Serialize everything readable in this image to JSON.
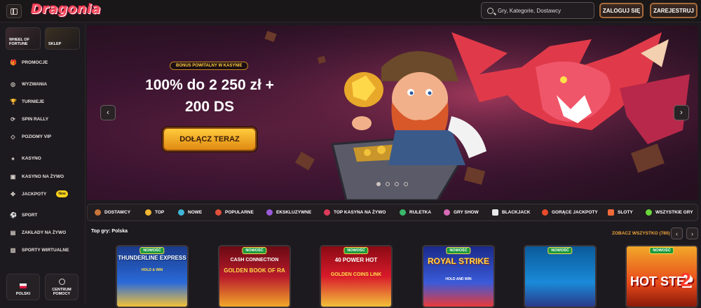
{
  "header": {
    "logo": "Dragonia",
    "search_placeholder": "Gry, Kategorie, Dostawcy",
    "login_label": "ZALOGUJ SIĘ",
    "register_label": "ZAREJESTRUJ"
  },
  "sidebar": {
    "tiles": [
      "WHEEL OF FORTUNE",
      "SKLEP"
    ],
    "items": [
      {
        "label": "PROMOCJE",
        "icon": "gift-icon"
      },
      {
        "label": "WYZWANIA",
        "icon": "target-icon"
      },
      {
        "label": "TURNIEJE",
        "icon": "trophy-icon"
      },
      {
        "label": "SPIN RALLY",
        "icon": "spin-icon"
      },
      {
        "label": "POZIOMY VIP",
        "icon": "diamond-icon"
      },
      {
        "label": "KASYNO",
        "icon": "cards-icon"
      },
      {
        "label": "KASYNO NA ŻYWO",
        "icon": "live-icon"
      },
      {
        "label": "JACKPOTY",
        "icon": "jackpot-icon",
        "badge": "New"
      },
      {
        "label": "SPORT",
        "icon": "ball-icon"
      },
      {
        "label": "ZAKŁADY NA ŻYWO",
        "icon": "live-bet-icon"
      },
      {
        "label": "SPORTY WIRTUALNE",
        "icon": "virtual-icon"
      }
    ],
    "language_label": "POLSKI",
    "help_label": "CENTRUM POMOCY"
  },
  "banner": {
    "tag": "BONUS POWITALNY W KASYNIE",
    "line1": "100% do 2 250 zł +",
    "line2": "200 DS",
    "cta": "DOŁĄCZ TERAZ",
    "slides": 4,
    "active_slide": 1
  },
  "categories": [
    {
      "label": "DOSTAWCY",
      "color": "#c8743a"
    },
    {
      "label": "TOP",
      "color": "#f2b632"
    },
    {
      "label": "NOWE",
      "color": "#3fb6d8"
    },
    {
      "label": "POPULARNE",
      "color": "#e0503a"
    },
    {
      "label": "EKSKLUZYWNE",
      "color": "#9a5ad8"
    },
    {
      "label": "TOP KASYNA NA ŻYWO",
      "color": "#e03a5a"
    },
    {
      "label": "RULETKA",
      "color": "#3ab86a"
    },
    {
      "label": "GRY SHOW",
      "color": "#d86ab8"
    },
    {
      "label": "BLACKJACK",
      "color": "#e8e8e8"
    },
    {
      "label": "GORĄCE JACKPOTY",
      "color": "#e84a2a"
    },
    {
      "label": "SLOTY",
      "color": "#f26a3a"
    },
    {
      "label": "WSZYSTKIE GRY",
      "color": "#6ad83a"
    }
  ],
  "top_games": {
    "title": "Top gry: Polska",
    "see_all": "ZOBACZ WSZYSTKO (780)",
    "new_label": "NOWOŚĆ",
    "games": [
      {
        "name": "THUNDERLINE EXPRESS",
        "sub": "HOLD & WIN"
      },
      {
        "name": "CASH CONNECTION",
        "sub": "GOLDEN BOOK OF RA"
      },
      {
        "name": "40 POWER HOT",
        "sub": "GOLDEN COINS LINK"
      },
      {
        "name": "ROYAL STRIKE",
        "sub": "HOLD AND WIN"
      },
      {
        "name": "",
        "sub": ""
      },
      {
        "name": "HOT STEP",
        "sub": "2"
      }
    ]
  }
}
